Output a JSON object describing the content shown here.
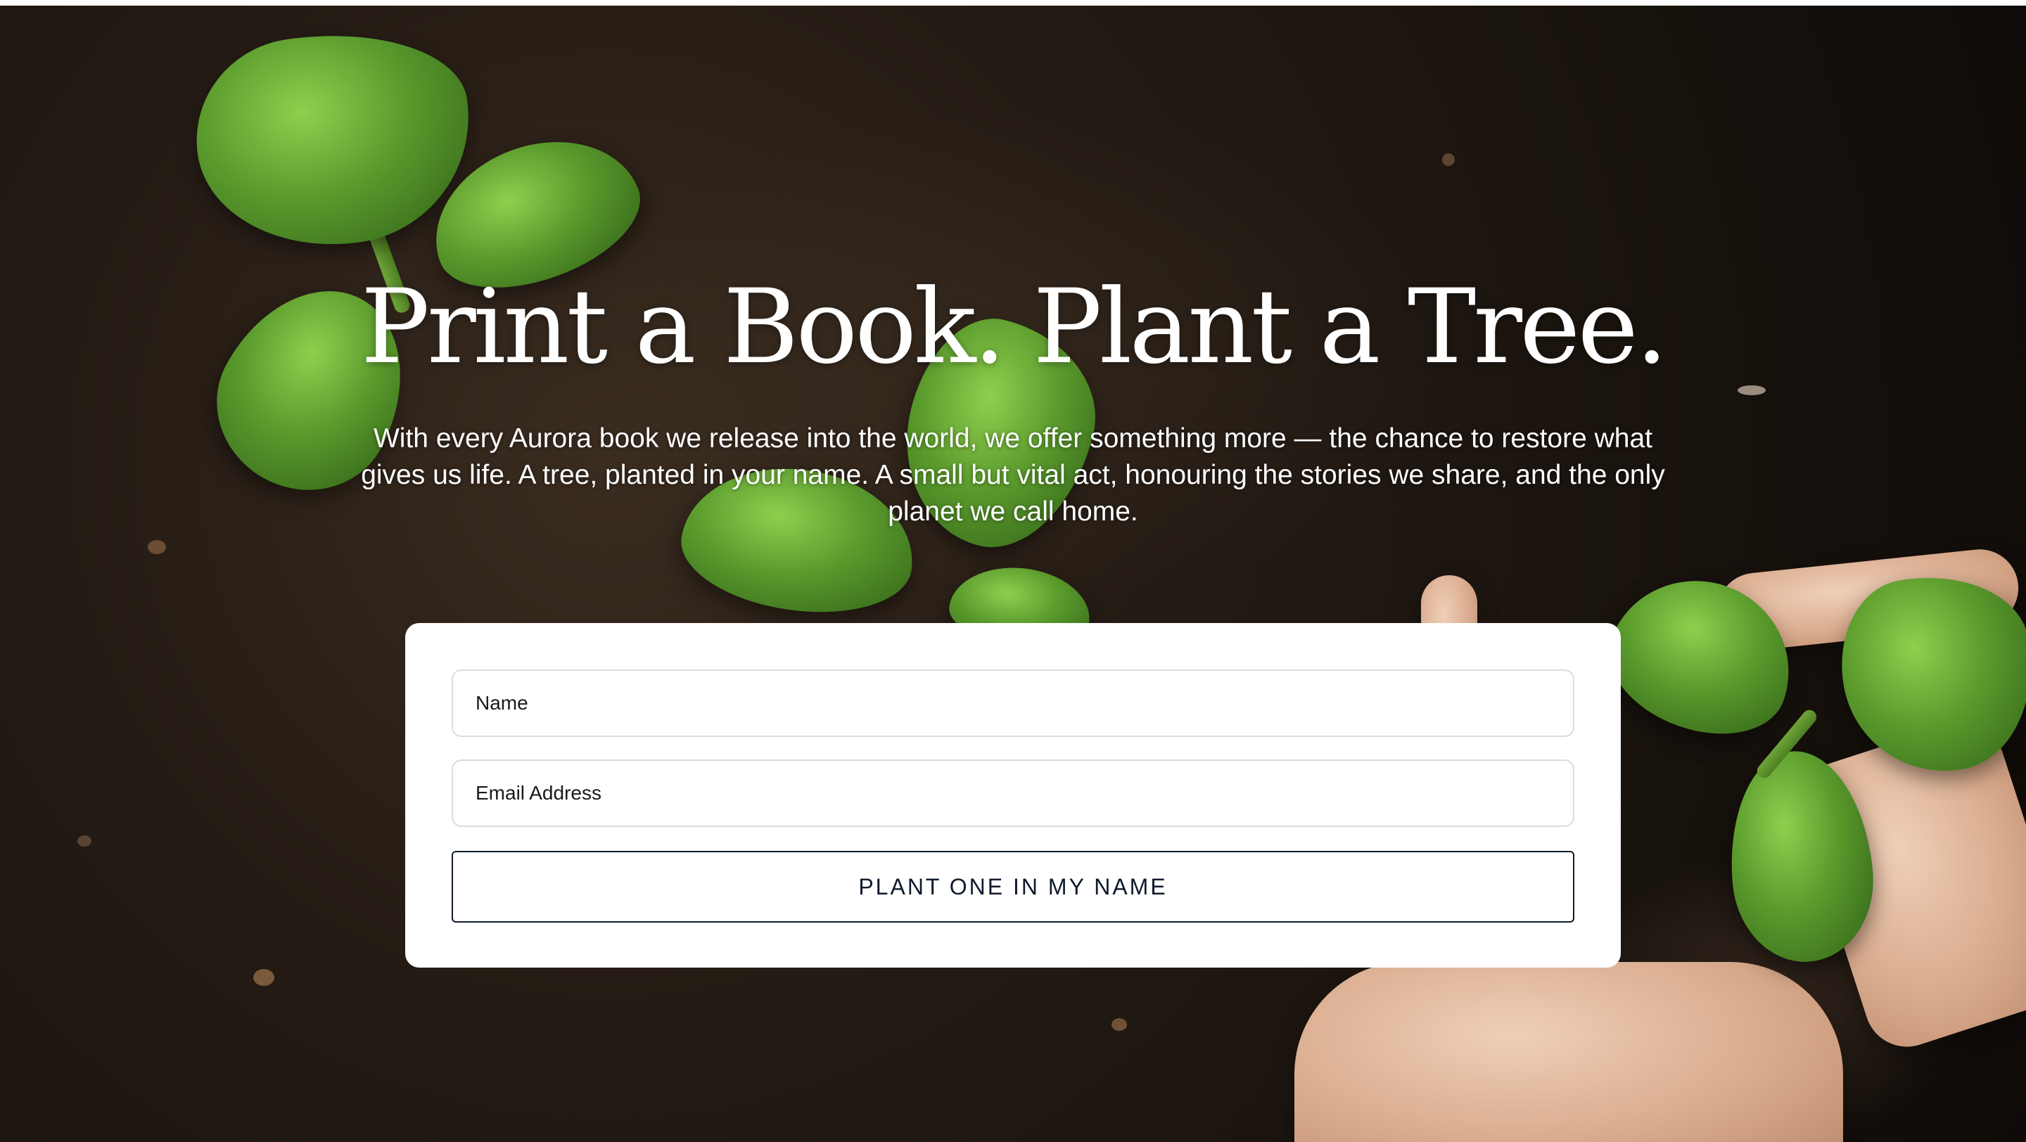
{
  "hero": {
    "headline": "Print a Book. Plant a Tree.",
    "intro": "With every Aurora book we release into the world, we offer something more — the chance to restore what gives us life. A tree, planted in your name. A small but vital act, honouring the stories we share, and the only planet we call home."
  },
  "form": {
    "name_placeholder": "Name",
    "email_placeholder": "Email Address",
    "submit_label": "PLANT ONE IN MY NAME"
  },
  "colors": {
    "soil": "#1e1711",
    "leaf": "#5a9a2c",
    "button_text": "#0f1a2c",
    "card": "#ffffff"
  }
}
